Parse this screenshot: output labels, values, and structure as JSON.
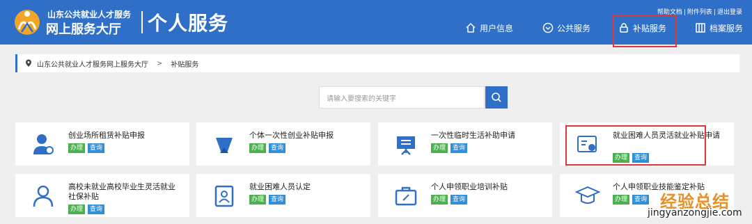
{
  "header": {
    "org_name": "山东公共就业人才服务",
    "hall_name": "网上服务大厅",
    "section_title": "个人服务",
    "util_links": [
      "帮助文档",
      "附件列表",
      "退出登录"
    ],
    "nav": [
      {
        "label": "用户信息",
        "icon": "home-icon"
      },
      {
        "label": "公共服务",
        "icon": "shield-icon"
      },
      {
        "label": "补贴服务",
        "icon": "lock-icon"
      },
      {
        "label": "档案服务",
        "icon": "grid-icon"
      }
    ],
    "accent_color": "#2f6fc7"
  },
  "breadcrumb": [
    "山东公共就业人才服务网上服务大厅",
    "补贴服务"
  ],
  "search": {
    "placeholder": "请输入要搜索的关键字"
  },
  "tag_labels": {
    "handle": "办理",
    "query": "查询"
  },
  "cards": [
    {
      "title": "创业场所租赁补贴申报",
      "icon": "person-icon"
    },
    {
      "title": "个体一次性创业补贴申报",
      "icon": "funnel-icon"
    },
    {
      "title": "一次性临时生活补助申请",
      "icon": "presentation-icon"
    },
    {
      "title": "就业困难人员灵活就业补贴申请",
      "icon": "certificate-icon"
    },
    {
      "title": "高校未就业高校毕业生灵活就业社保补贴",
      "icon": "user-outline-icon"
    },
    {
      "title": "就业困难人员认定",
      "icon": "id-card-icon"
    },
    {
      "title": "个人申领职业培训补贴",
      "icon": "briefcase-icon"
    },
    {
      "title": "个人申领职业技能鉴定补贴",
      "icon": "graduation-cap-icon"
    }
  ],
  "watermark": {
    "cn": "经验总结",
    "en": "jingyanzongjie.com"
  }
}
